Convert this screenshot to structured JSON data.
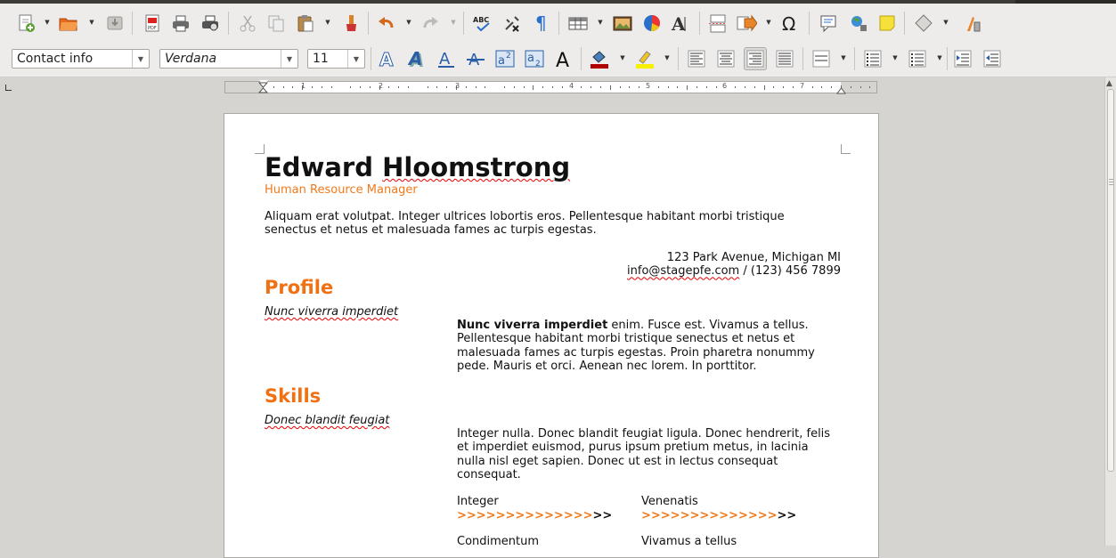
{
  "toolbar_standard": {
    "items": [
      "new-document",
      "open",
      "save",
      "export-pdf",
      "print-direct",
      "print-preview",
      "cut",
      "copy",
      "paste",
      "clone-formatting",
      "undo",
      "redo",
      "spelling",
      "autocorrect",
      "formatting-marks",
      "table",
      "image",
      "chart",
      "fontwork",
      "page-break",
      "field",
      "special-character",
      "comment",
      "navigator",
      "note",
      "shapes",
      "draw-functions"
    ]
  },
  "toolbar_formatting": {
    "paragraph_style": "Contact info",
    "font_name": "Verdana",
    "font_size": "11",
    "items": [
      "outline",
      "shadow",
      "underline",
      "strikethrough",
      "superscript",
      "subscript",
      "font-color-black",
      "char-background",
      "highlighting",
      "align-left",
      "align-center",
      "align-right",
      "justify",
      "line-spacing",
      "unordered-list",
      "ordered-list",
      "increase-indent",
      "decrease-indent"
    ]
  },
  "colors": {
    "accent": "#f07012",
    "subtitle": "#f08a3a",
    "spell_error": "#e00000"
  },
  "ruler": {
    "numbers": [
      "1",
      "2",
      "3",
      "4",
      "5",
      "6",
      "7"
    ]
  },
  "document": {
    "name": "Edward Hloomstrong",
    "job_title": "Human Resource Manager",
    "intro_line1": "Aliquam erat volutpat. Integer ultrices lobortis eros. Pellentesque habitant morbi tristique",
    "intro_line2": "senectus et netus et malesuada fames ac turpis egestas.",
    "address": "123 Park Avenue, Michigan MI",
    "contact_email": "info@stagepfe.com",
    "contact_phone": " / (123) 456 7899",
    "profile_heading": "Profile",
    "profile_sub": "Nunc viverra imperdiet",
    "profile_bold": "Nunc viverra imperdiet",
    "profile_line1": " enim. Fusce est. Vivamus a tellus.",
    "profile_line2": "Pellentesque habitant morbi tristique senectus et netus et",
    "profile_line3": "malesuada fames ac turpis egestas. Proin pharetra nonummy",
    "profile_line4": "pede. Mauris et orci. Aenean nec lorem. In porttitor.",
    "skills_heading": "Skills",
    "skills_sub": "Donec blandit feugiat",
    "skills_line1": "Integer nulla. Donec blandit feugiat ligula. Donec hendrerit, felis",
    "skills_line2": "et imperdiet euismod, purus ipsum pretium metus, in lacinia",
    "skills_line3": "nulla nisl eget sapien. Donec ut est in lectus consequat",
    "skills_line4": "consequat.",
    "skill_a_name": "Integer",
    "skill_b_name": "Venenatis",
    "skill_c_name": "Condimentum",
    "skill_d_name": "Vivamus a tellus",
    "skill_bar_orange": ">>>>>>>>>>>>>>",
    "skill_bar_black": ">>"
  }
}
